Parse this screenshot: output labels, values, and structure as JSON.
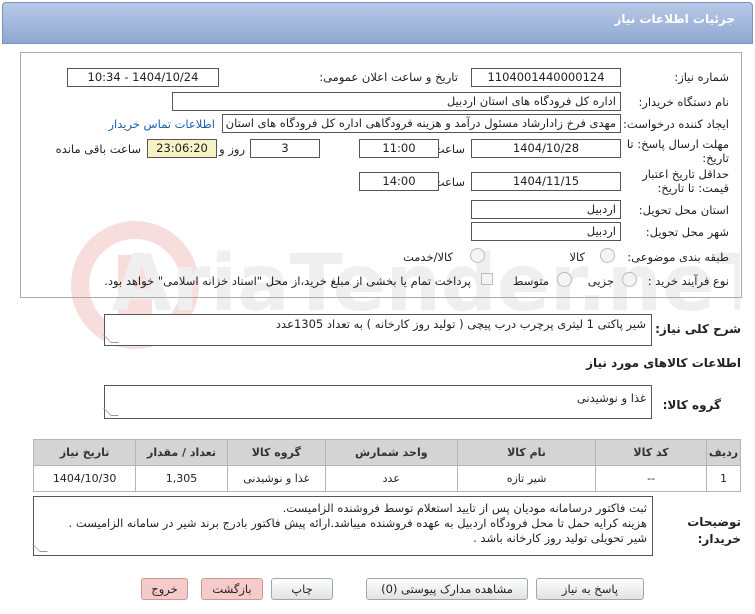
{
  "header": {
    "title": "جزئیات اطلاعات نیاز"
  },
  "watermark": {
    "text": "AriaTender.neT"
  },
  "form": {
    "need_number_label": "شماره نیاز:",
    "need_number": "1104001440000124",
    "announce_label": "تاریخ و ساعت اعلان عمومی:",
    "announce_value": "1404/10/24 - 10:34",
    "buyer_org_label": "نام دستگاه خریدار:",
    "buyer_org": "اداره کل فرودگاه های استان اردبیل",
    "creator_label": "ایجاد کننده درخواست:",
    "creator": "مهدی فرخ زادارشاد مسئول درآمد و هزینه فرودگاهی اداره کل فرودگاه های استان اردبیل",
    "contact_link": "اطلاعات تماس خریدار",
    "reply_deadline_label": "مهلت ارسال پاسخ: تا تاریخ:",
    "reply_date": "1404/10/28",
    "time_label": "ساعت",
    "reply_time": "11:00",
    "days_value": "3",
    "days_label": "روز و",
    "remaining_time": "23:06:20",
    "remaining_label": "ساعت باقی مانده",
    "validity_label": "حداقل تاریخ اعتبار قیمت: تا تاریخ:",
    "validity_date": "1404/11/15",
    "validity_time": "14:00",
    "province_label": "استان محل تحویل:",
    "province": "اردبیل",
    "city_label": "شهر محل تحویل:",
    "city": "اردبیل",
    "category_label": "طبقه بندی موضوعی:",
    "category_options": [
      "کالا",
      "کالا/خدمت"
    ],
    "process_label": "نوع فرآیند خرید :",
    "process_options": [
      "جزیی",
      "متوسط"
    ],
    "payment_note": "پرداخت تمام یا بخشی از مبلغ خرید،از محل \"اسناد خزانه اسلامی\" خواهد بود."
  },
  "general_desc_label": "شرح کلی نیاز:",
  "general_desc": "شیر پاکتی 1 لیتری پرچرب درب پیچی ( تولید روز کارخانه )  به تعداد 1305عدد",
  "goods_info_title": "اطلاعات کالاهای مورد نیاز",
  "goods_group_label": "گروه کالا:",
  "goods_group": "غذا و نوشیدنی",
  "table": {
    "headers": [
      "ردیف",
      "کد کالا",
      "نام کالا",
      "واحد شمارش",
      "گروه کالا",
      "تعداد / مقدار",
      "تاریخ نیاز"
    ],
    "rows": [
      [
        "1",
        "--",
        "شیر تازه",
        "عدد",
        "غذا و نوشیدنی",
        "1,305",
        "1404/10/30"
      ]
    ]
  },
  "buyer_notes_label": "توضیحات خریدار:",
  "buyer_notes": [
    "ثبت فاکتور درسامانه مودیان پس از تایید استعلام توسط فروشنده الزامیست.",
    "هزینه کرایه حمل تا محل فرودگاه اردبیل به عهده فروشنده میباشد.ارائه پیش فاکتور بادرج برند شیر در سامانه الزامیست .",
    "شیر تحویلی تولید روز کارخانه باشد ."
  ],
  "buttons": {
    "reply": "پاسخ به نیاز",
    "view_docs": "مشاهده مدارک پیوستی (0)",
    "print": "چاپ",
    "back": "بازگشت",
    "exit": "خروج"
  }
}
